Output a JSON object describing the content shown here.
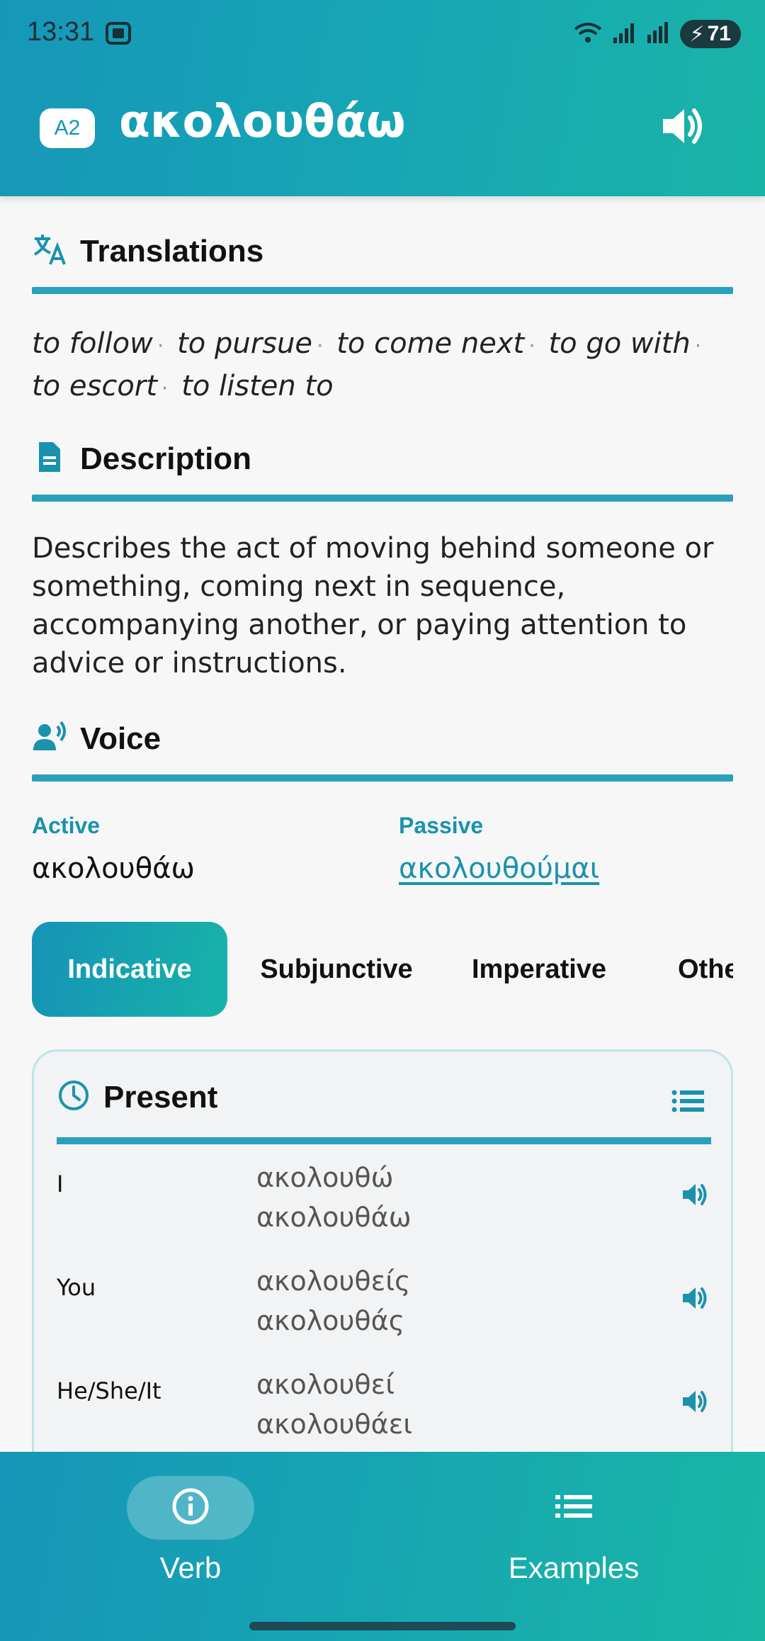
{
  "status": {
    "time": "13:31",
    "battery": "71"
  },
  "header": {
    "level": "A2",
    "title": "ακολουθάω"
  },
  "translations": {
    "title": "Translations",
    "items": [
      "to follow",
      "to pursue",
      "to come next",
      "to go with",
      "to escort",
      "to listen to"
    ]
  },
  "description": {
    "title": "Description",
    "text": "Describes the act of moving behind someone or something, coming next in sequence, accompanying another, or paying attention to advice or instructions."
  },
  "voice": {
    "title": "Voice",
    "active_label": "Active",
    "active_value": "ακολουθάω",
    "passive_label": "Passive",
    "passive_value": "ακολουθούμαι"
  },
  "mood_tabs": [
    {
      "label": "Indicative",
      "active": true
    },
    {
      "label": "Subjunctive",
      "active": false
    },
    {
      "label": "Imperative",
      "active": false
    },
    {
      "label": "Other",
      "active": false
    }
  ],
  "tense_card": {
    "title": "Present",
    "rows": [
      {
        "pronoun": "I",
        "forms": [
          "ακολουθώ",
          "ακολουθάω"
        ]
      },
      {
        "pronoun": "You",
        "forms": [
          "ακολουθείς",
          "ακολουθάς"
        ]
      },
      {
        "pronoun": "He/She/It",
        "forms": [
          "ακολουθεί",
          "ακολουθάει"
        ]
      }
    ]
  },
  "bottom_nav": {
    "verb_label": "Verb",
    "examples_label": "Examples"
  },
  "colors": {
    "accent": "#1a92ad",
    "rule": "#2aa0bd",
    "gradient_start": "#1596b8",
    "gradient_end": "#19b6a4"
  }
}
